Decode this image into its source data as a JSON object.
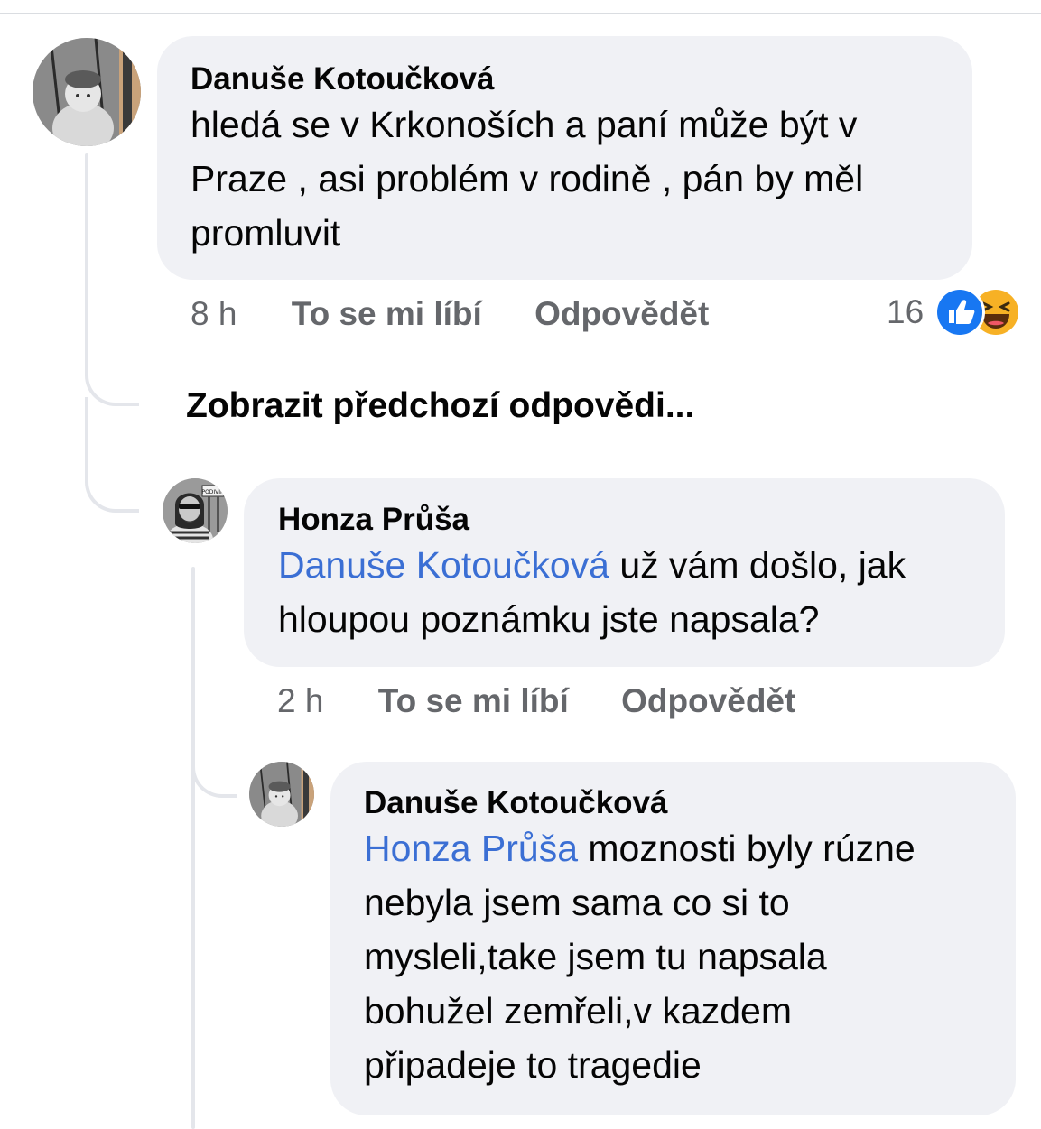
{
  "colors": {
    "bubble": "#f0f1f5",
    "mention": "#3b6fd4",
    "meta": "#65676b",
    "thread_line": "#e4e6eb",
    "like_blue": "#1877f2",
    "haha_yellow": "#f7b125"
  },
  "comment1": {
    "author": "Danuše Kotoučková",
    "avatar_icon": "avatar-photo-child",
    "lines": [
      "hledá se v Krkonoších a paní může být v",
      "Praze , asi problém v rodině , pán by měl",
      "promluvit"
    ],
    "time": "8 h",
    "like_label": "To se mi líbí",
    "reply_label": "Odpovědět",
    "reaction_count": "16",
    "reaction_icons": [
      "like-icon",
      "haha-icon"
    ]
  },
  "view_previous": "Zobrazit předchozí odpovědi...",
  "reply1": {
    "author": "Honza Průša",
    "avatar_icon": "avatar-photo-man",
    "mention": "Danuše Kotoučková",
    "line1_rest": " už vám došlo, jak",
    "line2": "hloupou poznámku jste napsala?",
    "time": "2 h",
    "like_label": "To se mi líbí",
    "reply_label": "Odpovědět"
  },
  "reply2": {
    "author": "Danuše Kotoučková",
    "avatar_icon": "avatar-photo-child",
    "mention": "Honza Průša",
    "line1_rest": " moznosti byly rúzne",
    "lines": [
      "nebyla jsem sama co si to",
      "mysleli,take jsem tu napsala",
      "bohužel zemřeli,v kazdem",
      "připadeje to tragedie"
    ]
  }
}
